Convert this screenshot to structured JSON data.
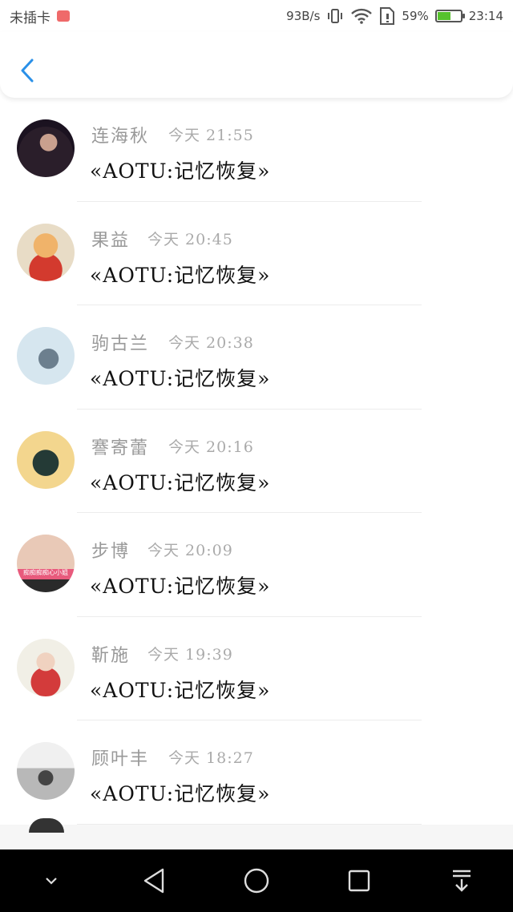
{
  "status_bar": {
    "carrier": "未插卡",
    "speed": "93B/s",
    "battery_percent": "59%",
    "battery_level": 0.59,
    "time": "23:14"
  },
  "header": {
    "back_icon": "chevron-left-icon",
    "accent_color": "#2a90e8"
  },
  "list": [
    {
      "name": "连海秋",
      "time": "今天 21:55",
      "title": "«AOTU:记忆恢复»",
      "avatar": "avatar-girl-dark-hair"
    },
    {
      "name": "果益",
      "time": "今天 20:45",
      "title": "«AOTU:记忆恢复»",
      "avatar": "avatar-orange-hair"
    },
    {
      "name": "驹古兰",
      "time": "今天 20:38",
      "title": "«AOTU:记忆恢复»",
      "avatar": "avatar-pale-blue"
    },
    {
      "name": "謇寄蕾",
      "time": "今天 20:16",
      "title": "«AOTU:记忆恢复»",
      "avatar": "avatar-cat-ears"
    },
    {
      "name": "步博",
      "time": "今天 20:09",
      "title": "«AOTU:记忆恢复»",
      "avatar": "avatar-woman-caption",
      "avatar_caption": "痴痴痴痴心小姐"
    },
    {
      "name": "靳施",
      "time": "今天 19:39",
      "title": "«AOTU:记忆恢复»",
      "avatar": "avatar-red-scarf"
    },
    {
      "name": "顾叶丰",
      "time": "今天 18:27",
      "title": "«AOTU:记忆恢复»",
      "avatar": "avatar-locks"
    }
  ],
  "nav": {
    "down_icon": "chevron-down-icon",
    "back_icon": "triangle-back-icon",
    "home_icon": "circle-home-icon",
    "recent_icon": "square-recent-icon",
    "notif_icon": "pull-down-icon"
  }
}
